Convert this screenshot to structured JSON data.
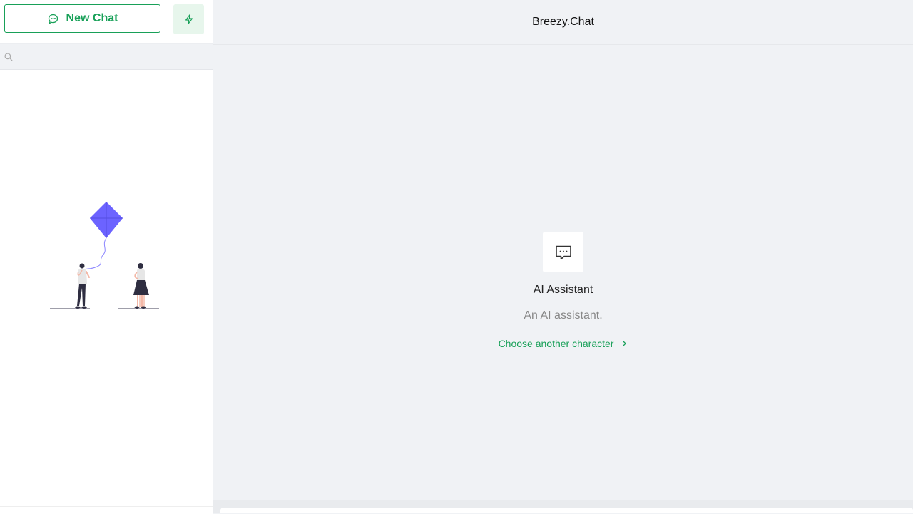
{
  "sidebar": {
    "new_chat_label": "New Chat",
    "search": {
      "placeholder": "",
      "value": ""
    },
    "icons": {
      "new_chat": "chat-bubble-icon",
      "flash": "lightning-icon",
      "search": "search-icon",
      "empty": "kite-illustration"
    }
  },
  "header": {
    "title": "Breezy.Chat"
  },
  "character": {
    "icon": "message-dots-icon",
    "name": "AI Assistant",
    "description": "An AI assistant.",
    "choose_label": "Choose another character",
    "choose_icon": "chevron-right-icon"
  },
  "colors": {
    "accent": "#18a058",
    "accent_soft": "#e7f6ec",
    "background": "#f0f2f5",
    "kite": "#6c63ff"
  }
}
